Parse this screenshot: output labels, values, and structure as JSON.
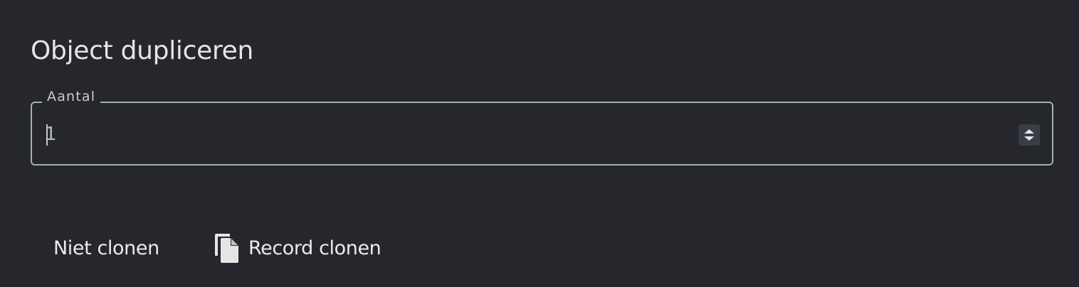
{
  "dialog": {
    "title": "Object dupliceren"
  },
  "quantity_field": {
    "label": "Aantal",
    "value": "1"
  },
  "actions": {
    "cancel_label": "Niet clonen",
    "clone_label": "Record clonen",
    "clone_icon": "copy-icon"
  },
  "colors": {
    "background": "#25272c",
    "field_border": "#a9aeb6",
    "text": "#e6e6e6"
  }
}
